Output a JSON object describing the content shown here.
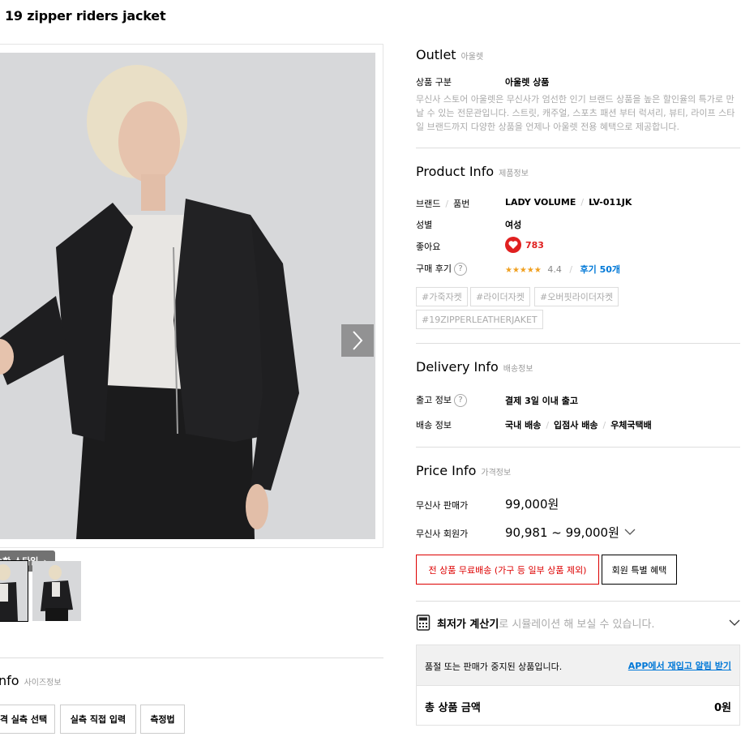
{
  "product": {
    "title": "19 zipper riders jacket"
  },
  "gallery": {
    "similar_style_label": "숫한 스타일",
    "thumbnails": 2
  },
  "size_section": {
    "title": "nfo",
    "subtitle": "사이즈정보",
    "buttons": [
      "격 실측 선택",
      "실측 직접 입력",
      "측정법"
    ]
  },
  "outlet": {
    "title": "Outlet",
    "subtitle": "아울렛",
    "category_label": "상품 구분",
    "category_value": "아울렛 상품",
    "description": "무신사 스토어 아울렛은 무신사가 엄선한 인기 브랜드 상품을 높은 할인율의 특가로 만날 수 있는 전문관입니다. 스트릿, 캐주얼, 스포츠 패션 부터 럭셔리, 뷰티, 라이프 스타일 브랜드까지 다양한 상품을 언제나 아울렛 전용 혜택으로 제공합니다."
  },
  "product_info": {
    "title": "Product Info",
    "subtitle": "제품정보",
    "brand_label": "브랜드",
    "item_label": "품번",
    "brand": "LADY VOLUME",
    "item_no": "LV-011JK",
    "gender_label": "성별",
    "gender": "여성",
    "likes_label": "좋아요",
    "likes": "783",
    "review_label": "구매 후기",
    "rating_stars": "★★★★★",
    "rating": "4.4",
    "review_link": "후기 50개",
    "tags": [
      "#가죽자켓",
      "#라이더자켓",
      "#오버핏라이더자켓",
      "#19ZIPPERLEATHERJAKET"
    ]
  },
  "delivery": {
    "title": "Delivery Info",
    "subtitle": "배송정보",
    "ship_label": "출고 정보",
    "ship_value": "결제 3일 이내 출고",
    "method_label": "배송 정보",
    "method_values": [
      "국내 배송",
      "입점사 배송",
      "우체국택배"
    ]
  },
  "price": {
    "title": "Price Info",
    "subtitle": "가격정보",
    "sale_label": "무신사 판매가",
    "sale_value": "99,000원",
    "member_label": "무신사 회원가",
    "member_value": "90,981 ~ 99,000원",
    "free_shipping": "전 상품 무료배송 (가구 등 일부 상품 제외)",
    "member_benefit": "회원 특별 혜택"
  },
  "calculator": {
    "bold": "최저가 계산기",
    "rest": "로 시뮬레이션 해 보실 수 있습니다."
  },
  "notice": {
    "text": "품절 또는 판매가 중지된 상품입니다.",
    "link": "APP에서 재입고 알림 받기",
    "total_label": "총 상품 금액",
    "total_value": "0원"
  },
  "colors": {
    "accent_red": "#d00000",
    "link_blue": "#0078d7",
    "heart": "#e02020"
  }
}
